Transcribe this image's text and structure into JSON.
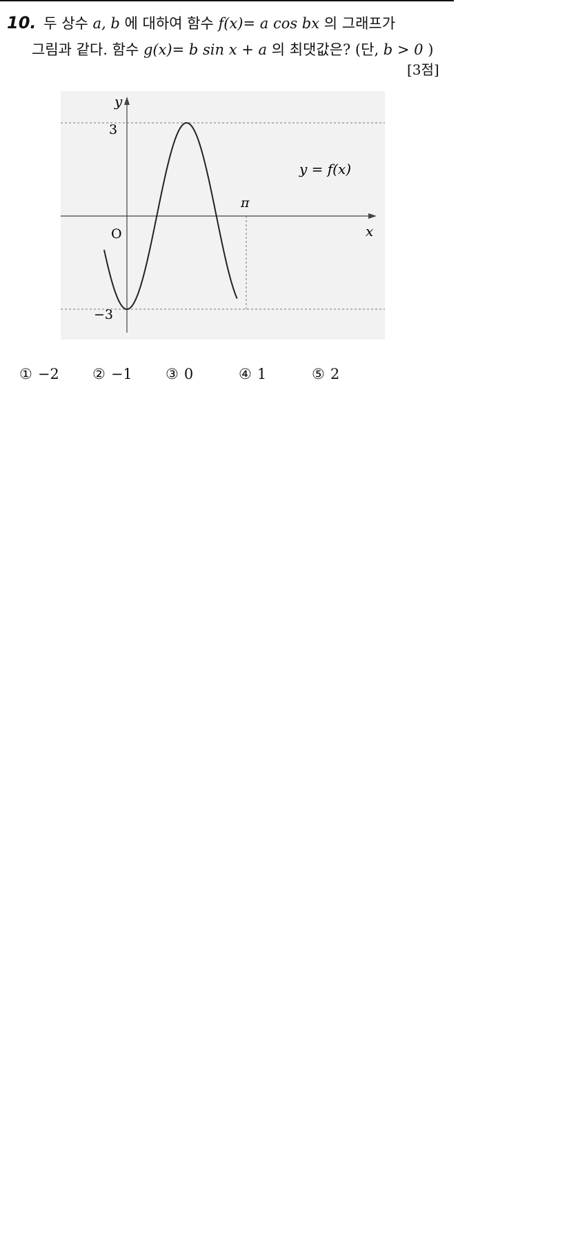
{
  "question": {
    "number": "10.",
    "line1_a": "두 상수 ",
    "line1_vars": "a, b",
    "line1_b": "에 대하여 함수 ",
    "line1_func": "f(x)= a cos bx",
    "line1_c": "의 그래프가",
    "line2_a": "그림과 같다. 함수 ",
    "line2_func": "g(x)= b sin x + a",
    "line2_b": "의 최댓값은? (단, ",
    "line2_cond": "b > 0",
    "line2_c": ")",
    "points": "[3점]"
  },
  "figure": {
    "y_axis_label": "y",
    "x_axis_label": "x",
    "origin_label": "O",
    "y_max_label": "3",
    "y_min_label": "−3",
    "pi_label": "π",
    "curve_label": "y = f(x)",
    "amplitude": 3,
    "function": "-3cos(2x)",
    "x_range": [
      -0.6,
      2.9
    ],
    "curve_color": "#222222",
    "background": "#f2f2f2"
  },
  "choices": [
    {
      "mark": "①",
      "value": "−2"
    },
    {
      "mark": "②",
      "value": "−1"
    },
    {
      "mark": "③",
      "value": "0"
    },
    {
      "mark": "④",
      "value": "1"
    },
    {
      "mark": "⑤",
      "value": "2"
    }
  ]
}
